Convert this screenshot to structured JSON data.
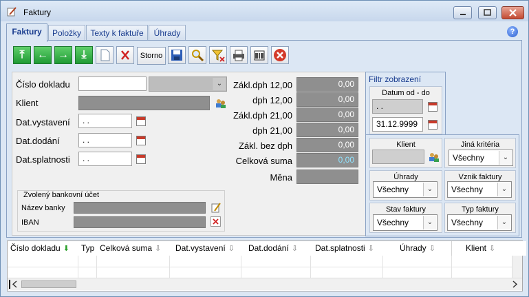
{
  "window": {
    "title": "Faktury"
  },
  "tabs": [
    {
      "label": "Faktury",
      "active": true
    },
    {
      "label": "Položky",
      "active": false
    },
    {
      "label": "Texty k faktuře",
      "active": false
    },
    {
      "label": "Úhrady",
      "active": false
    }
  ],
  "toolbar": {
    "storno_label": "Storno"
  },
  "form": {
    "cislo_dokladu": {
      "label": "Číslo dokladu",
      "value": ""
    },
    "klient": {
      "label": "Klient",
      "value": ""
    },
    "dat_vystaveni": {
      "label": "Dat.vystavení",
      "value": ". ."
    },
    "dat_dodani": {
      "label": "Dat.dodání",
      "value": ". ."
    },
    "dat_splatnosti": {
      "label": "Dat.splatnosti",
      "value": ". ."
    }
  },
  "totals": [
    {
      "label": "Zákl.dph 12,00",
      "value": "0,00"
    },
    {
      "label": "dph 12,00",
      "value": "0,00"
    },
    {
      "label": "Zákl.dph 21,00",
      "value": "0,00"
    },
    {
      "label": "dph 21,00",
      "value": "0,00"
    },
    {
      "label": "Zákl. bez dph",
      "value": "0,00"
    },
    {
      "label": "Celková suma",
      "value": "0,00"
    },
    {
      "label": "Měna",
      "value": ""
    }
  ],
  "bank": {
    "group_label": "Zvolený bankovní účet",
    "name_label": "Název banky",
    "iban_label": "IBAN"
  },
  "filter": {
    "title": "Filtr zobrazení",
    "date_label": "Datum od - do",
    "date_from": ". .",
    "date_to": "31.12.9999",
    "klient_label": "Klient",
    "jina_label": "Jiná kritéria",
    "jina_value": "Všechny",
    "uhrady_label": "Úhrady",
    "uhrady_value": "Všechny",
    "vznik_label": "Vznik faktury",
    "vznik_value": "Všechny",
    "stav_label": "Stav faktury",
    "stav_value": "Všechny",
    "typ_label": "Typ faktury",
    "typ_value": "Všechny"
  },
  "grid": {
    "columns": [
      "Číslo dokladu",
      "Typ",
      "Celková suma",
      "Dat.vystavení",
      "Dat.dodání",
      "Dat.splatnosti",
      "Úhrady",
      "Klient"
    ]
  },
  "colors": {
    "accent_tab": "#1a3d8f",
    "green": "#1f9a35",
    "total_highlight": "#8fe3ff"
  }
}
